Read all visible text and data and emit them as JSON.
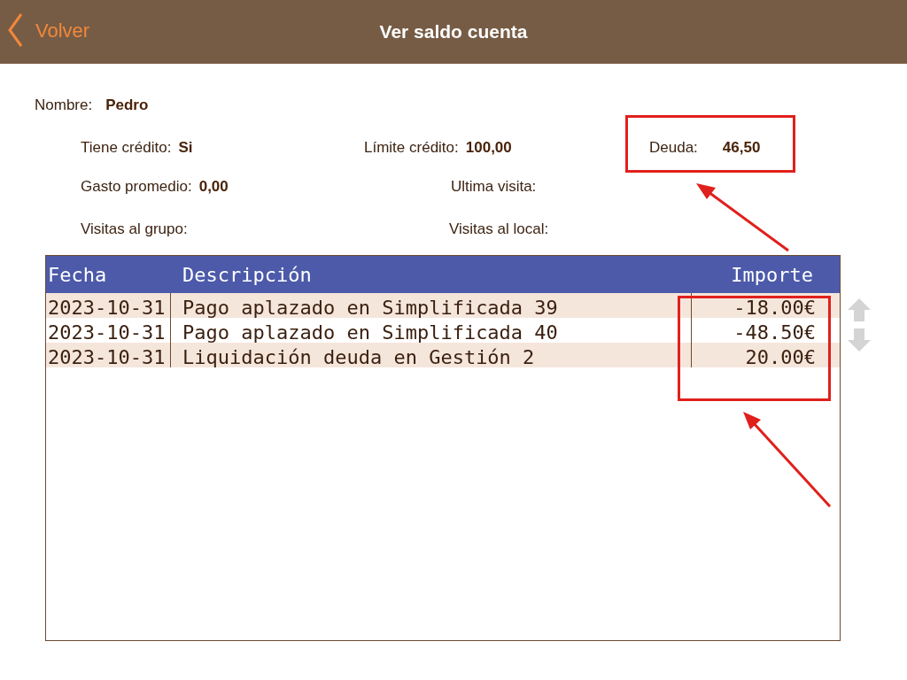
{
  "header": {
    "back": "Volver",
    "title": "Ver saldo cuenta"
  },
  "info_rows": [
    [
      {
        "label": "Nombre:",
        "value": "Pedro"
      }
    ],
    [
      {
        "label": "Tiene crédito:",
        "value": "Si"
      },
      {
        "label": "Límite crédito:",
        "value": "100,00"
      },
      {
        "label": "Deuda:",
        "value": "46,50"
      }
    ],
    [
      {
        "label": "Gasto promedio:",
        "value": "0,00"
      },
      {
        "label": "Ultima visita:"
      }
    ],
    [
      {
        "label": "Visitas al grupo:"
      },
      {
        "label": "Visitas al local:"
      }
    ]
  ],
  "table": {
    "columns": [
      "Fecha",
      "Descripción",
      "Importe"
    ],
    "rows": [
      [
        "2023-10-31",
        "Pago aplazado en Simplificada 39",
        "-18.00€"
      ],
      [
        "2023-10-31",
        "Pago aplazado en Simplificada 40",
        "-48.50€"
      ],
      [
        "2023-10-31",
        "Liquidación deuda en Gestión 2",
        "20.00€"
      ]
    ]
  }
}
